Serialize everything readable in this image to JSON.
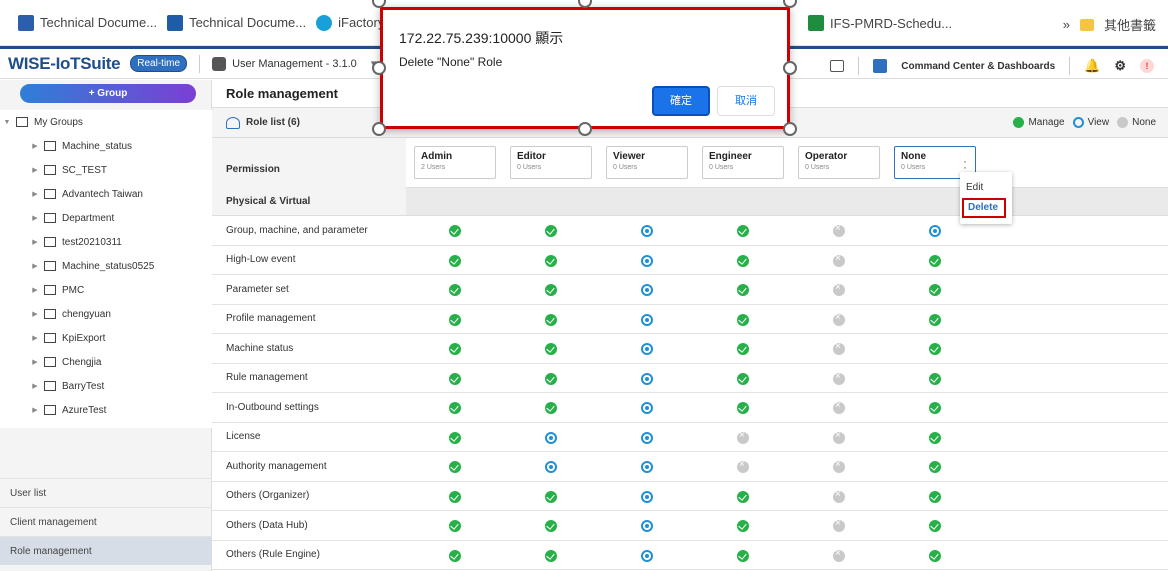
{
  "bookmarks": {
    "items": [
      "Technical Docume...",
      "Technical Docume...",
      "iFactory - Ho"
    ],
    "item_right": "IFS-PMRD-Schedu...",
    "more": "»",
    "other_folder": "其他書籤"
  },
  "header": {
    "logo": "WISE-IoTSuite",
    "badge": "Real-time",
    "module": "User Management - 3.1.0",
    "command_center": "Command Center & Dashboards"
  },
  "sidebar": {
    "group_button": "+ Group",
    "root": "My Groups",
    "groups": [
      "Machine_status",
      "SC_TEST",
      "Advantech Taiwan",
      "Department",
      "test20210311",
      "Machine_status0525",
      "PMC",
      "chengyuan",
      "KpiExport",
      "Chengjia",
      "BarryTest",
      "AzureTest"
    ],
    "nav": [
      "User list",
      "Client management",
      "Role management"
    ]
  },
  "main": {
    "title": "Role management",
    "role_list": "Role list (6)",
    "legend": {
      "manage": "Manage",
      "view": "View",
      "none": "None"
    },
    "permission_header": "Permission",
    "section": "Physical & Virtual",
    "roles": [
      {
        "name": "Admin",
        "users": "2 Users"
      },
      {
        "name": "Editor",
        "users": "0 Users"
      },
      {
        "name": "Viewer",
        "users": "0 Users"
      },
      {
        "name": "Engineer",
        "users": "0 Users"
      },
      {
        "name": "Operator",
        "users": "0 Users"
      },
      {
        "name": "None",
        "users": "0 Users"
      }
    ],
    "permissions": [
      {
        "label": "Group, machine, and parameter",
        "states": [
          "manage",
          "manage",
          "view",
          "manage",
          "none",
          "view"
        ]
      },
      {
        "label": "High-Low event",
        "states": [
          "manage",
          "manage",
          "view",
          "manage",
          "none",
          "manage"
        ]
      },
      {
        "label": "Parameter set",
        "states": [
          "manage",
          "manage",
          "view",
          "manage",
          "none",
          "manage"
        ]
      },
      {
        "label": "Profile management",
        "states": [
          "manage",
          "manage",
          "view",
          "manage",
          "none",
          "manage"
        ]
      },
      {
        "label": "Machine status",
        "states": [
          "manage",
          "manage",
          "view",
          "manage",
          "none",
          "manage"
        ]
      },
      {
        "label": "Rule management",
        "states": [
          "manage",
          "manage",
          "view",
          "manage",
          "none",
          "manage"
        ]
      },
      {
        "label": "In-Outbound settings",
        "states": [
          "manage",
          "manage",
          "view",
          "manage",
          "none",
          "manage"
        ]
      },
      {
        "label": "License",
        "states": [
          "manage",
          "view",
          "view",
          "none",
          "none",
          "manage"
        ]
      },
      {
        "label": "Authority management",
        "states": [
          "manage",
          "view",
          "view",
          "none",
          "none",
          "manage"
        ]
      },
      {
        "label": "Others (Organizer)",
        "states": [
          "manage",
          "manage",
          "view",
          "manage",
          "none",
          "manage"
        ]
      },
      {
        "label": "Others (Data Hub)",
        "states": [
          "manage",
          "manage",
          "view",
          "manage",
          "none",
          "manage"
        ]
      },
      {
        "label": "Others (Rule Engine)",
        "states": [
          "manage",
          "manage",
          "view",
          "manage",
          "none",
          "manage"
        ]
      }
    ]
  },
  "dropdown": {
    "edit": "Edit",
    "delete": "Delete"
  },
  "dialog": {
    "title": "172.22.75.239:10000 顯示",
    "message": "Delete \"None\" Role",
    "ok": "確定",
    "cancel": "取消"
  },
  "colors": {
    "manage": "#27b04a",
    "view": "#1e90d6",
    "none": "#c9c9c9",
    "accent": "#1a73e8",
    "highlight": "#cc0000"
  }
}
